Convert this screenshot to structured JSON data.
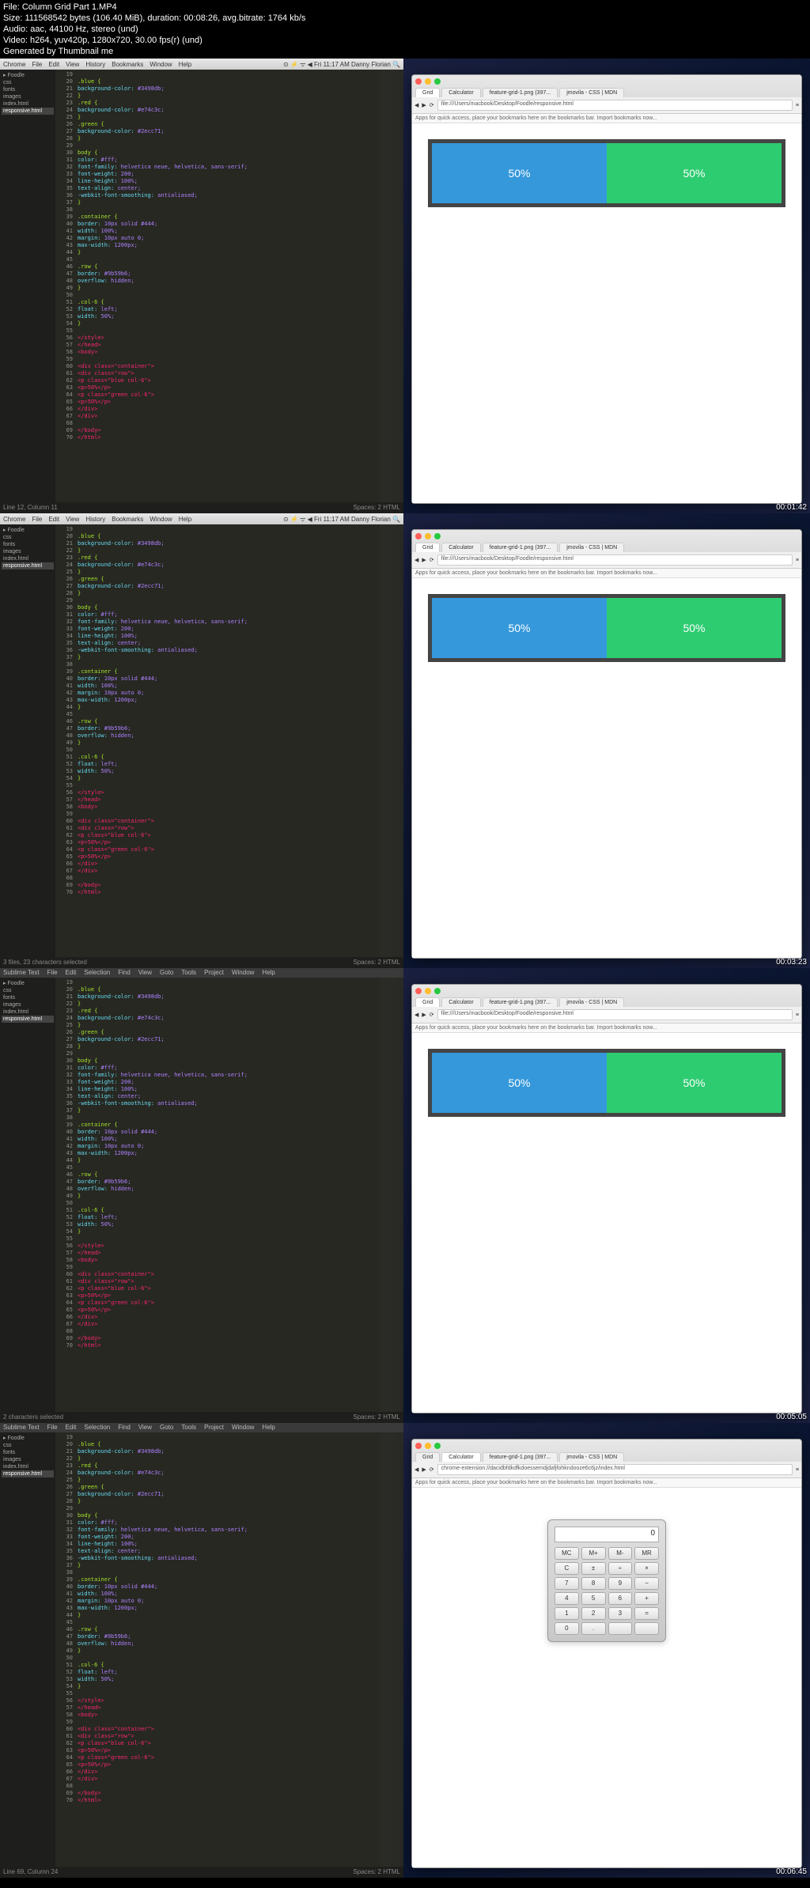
{
  "info": {
    "file": "File: Column Grid Part 1.MP4",
    "size": "Size: 111568542 bytes (106.40 MiB), duration: 00:08:26, avg.bitrate: 1764 kb/s",
    "audio": "Audio: aac, 44100 Hz, stereo (und)",
    "video": "Video: h264, yuv420p, 1280x720, 30.00 fps(r) (und)",
    "generated": "Generated by Thumbnail me"
  },
  "mac_menu": {
    "items": [
      "Chrome",
      "File",
      "Edit",
      "View",
      "History",
      "Bookmarks",
      "Window",
      "Help"
    ],
    "right": "⊙ ⚡ ᯤ ◀ Fri 11:17 AM  Danny Florian  🔍"
  },
  "sublime_menu": {
    "items": [
      "Sublime Text",
      "File",
      "Edit",
      "Selection",
      "Find",
      "View",
      "Goto",
      "Tools",
      "Project",
      "Window",
      "Help"
    ]
  },
  "sidebar": {
    "items": [
      "▸ Foodle",
      "  css",
      "  fonts",
      "  images",
      "  index.html"
    ],
    "active": "responsive.html"
  },
  "browser": {
    "tabs": [
      "Grid",
      "Calculator",
      "feature-grid-1.png (397...",
      "jmovila - CSS | MDN"
    ],
    "url": "file:///Users/macbook/Desktop/Foodle/responsive.html",
    "bookmark": "Apps  for quick access, place your bookmarks here on the bookmarks bar.  Import bookmarks now..."
  },
  "grid": {
    "left": "50%",
    "right": "50%"
  },
  "timestamps": [
    "00:01:42",
    "00:03:23",
    "00:05:05",
    "00:06:45"
  ],
  "status": [
    {
      "left": "Line 12, Column 11",
      "right": "Spaces: 2    HTML"
    },
    {
      "left": "3 files, 23 characters selected",
      "right": "Spaces: 2    HTML"
    },
    {
      "left": "2 characters selected",
      "right": "Spaces: 2    HTML"
    },
    {
      "left": "Line 69, Column 24",
      "right": "Spaces: 2    HTML"
    }
  ],
  "url4": "chrome-extension://dacidbfdkdfkdoessemdjdafjfohkndooze6c6jz/index.html",
  "calc": {
    "display": "0",
    "buttons": [
      "MC",
      "M+",
      "M-",
      "MR",
      "C",
      "±",
      "÷",
      "×",
      "7",
      "8",
      "9",
      "−",
      "4",
      "5",
      "6",
      "+",
      "1",
      "2",
      "3",
      "=",
      "0",
      ".",
      "",
      ""
    ]
  },
  "code_css": [
    {
      "n": "19",
      "sel": "  ",
      "prop": "",
      "val": ""
    },
    {
      "n": "20",
      "sel": ".blue {",
      "prop": "",
      "val": ""
    },
    {
      "n": "21",
      "sel": "",
      "prop": "  background-color:",
      "val": " #3498db;"
    },
    {
      "n": "22",
      "sel": "}",
      "prop": "",
      "val": ""
    },
    {
      "n": "23",
      "sel": ".red {",
      "prop": "",
      "val": ""
    },
    {
      "n": "24",
      "sel": "",
      "prop": "  background-color:",
      "val": " #e74c3c;"
    },
    {
      "n": "25",
      "sel": "}",
      "prop": "",
      "val": ""
    },
    {
      "n": "26",
      "sel": ".green {",
      "prop": "",
      "val": ""
    },
    {
      "n": "27",
      "sel": "",
      "prop": "  background-color:",
      "val": " #2ecc71;"
    },
    {
      "n": "28",
      "sel": "}",
      "prop": "",
      "val": ""
    },
    {
      "n": "29",
      "sel": "",
      "prop": "",
      "val": ""
    },
    {
      "n": "30",
      "sel": "body {",
      "prop": "",
      "val": ""
    },
    {
      "n": "31",
      "sel": "",
      "prop": "  color:",
      "val": " #fff;"
    },
    {
      "n": "32",
      "sel": "",
      "prop": "  font-family:",
      "val": " helvetica neue, helvetica, sans-serif;"
    },
    {
      "n": "33",
      "sel": "",
      "prop": "  font-weight:",
      "val": " 200;"
    },
    {
      "n": "34",
      "sel": "",
      "prop": "  line-height:",
      "val": " 100%;"
    },
    {
      "n": "35",
      "sel": "",
      "prop": "  text-align:",
      "val": " center;"
    },
    {
      "n": "36",
      "sel": "",
      "prop": "  -webkit-font-smoothing:",
      "val": " antialiased;"
    },
    {
      "n": "37",
      "sel": "}",
      "prop": "",
      "val": ""
    },
    {
      "n": "38",
      "sel": "",
      "prop": "",
      "val": ""
    },
    {
      "n": "39",
      "sel": ".container {",
      "prop": "",
      "val": ""
    },
    {
      "n": "40",
      "sel": "",
      "prop": "  border:",
      "val": " 10px solid #444;"
    },
    {
      "n": "41",
      "sel": "",
      "prop": "  width:",
      "val": " 100%;"
    },
    {
      "n": "42",
      "sel": "",
      "prop": "  margin:",
      "val": " 10px auto 0;"
    },
    {
      "n": "43",
      "sel": "",
      "prop": "  max-width:",
      "val": " 1200px;"
    },
    {
      "n": "44",
      "sel": "}",
      "prop": "",
      "val": ""
    },
    {
      "n": "45",
      "sel": "",
      "prop": "",
      "val": ""
    },
    {
      "n": "46",
      "sel": ".row {",
      "prop": "",
      "val": ""
    },
    {
      "n": "47",
      "sel": "",
      "prop": "  border:",
      "val": " #9b59b6;"
    },
    {
      "n": "48",
      "sel": "",
      "prop": "  overflow:",
      "val": " hidden;"
    },
    {
      "n": "49",
      "sel": "}",
      "prop": "",
      "val": ""
    },
    {
      "n": "50",
      "sel": "",
      "prop": "",
      "val": ""
    },
    {
      "n": "51",
      "sel": ".col-6 {",
      "prop": "",
      "val": ""
    },
    {
      "n": "52",
      "sel": "",
      "prop": "  float:",
      "val": " left;"
    },
    {
      "n": "53",
      "sel": "",
      "prop": "  width:",
      "val": " 50%;"
    },
    {
      "n": "54",
      "sel": "}",
      "prop": "",
      "val": ""
    }
  ],
  "code_html": [
    {
      "n": "56",
      "t": "</style>"
    },
    {
      "n": "57",
      "t": "</head>"
    },
    {
      "n": "58",
      "t": "<body>"
    },
    {
      "n": "59",
      "t": ""
    },
    {
      "n": "60",
      "t": "  <div class=\"container\">"
    },
    {
      "n": "61",
      "t": "    <div class=\"row\">"
    },
    {
      "n": "62",
      "t": "      <p class=\"blue col-6\">"
    },
    {
      "n": "63",
      "t": "        <p>50%</p>"
    },
    {
      "n": "64",
      "t": "      <p class=\"green col-6\">"
    },
    {
      "n": "65",
      "t": "        <p>50%</p>"
    },
    {
      "n": "66",
      "t": "    </div>"
    },
    {
      "n": "67",
      "t": "  </div>"
    },
    {
      "n": "68",
      "t": ""
    },
    {
      "n": "69",
      "t": "</body>"
    },
    {
      "n": "70",
      "t": "</html>"
    }
  ]
}
